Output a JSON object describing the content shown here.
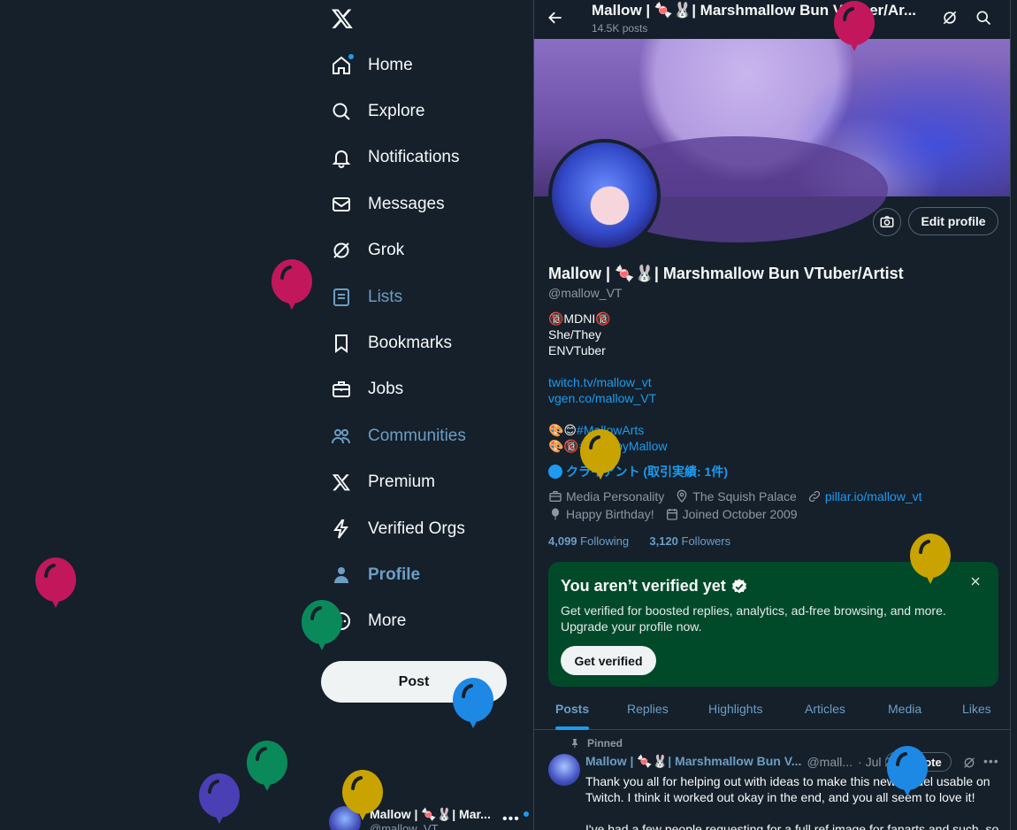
{
  "nav": {
    "items": [
      {
        "label": "Home",
        "icon": "home-icon"
      },
      {
        "label": "Explore",
        "icon": "search-icon"
      },
      {
        "label": "Notifications",
        "icon": "bell-icon"
      },
      {
        "label": "Messages",
        "icon": "mail-icon"
      },
      {
        "label": "Grok",
        "icon": "grok-icon"
      },
      {
        "label": "Lists",
        "icon": "list-icon"
      },
      {
        "label": "Bookmarks",
        "icon": "bookmark-icon"
      },
      {
        "label": "Jobs",
        "icon": "briefcase-icon"
      },
      {
        "label": "Communities",
        "icon": "communities-icon"
      },
      {
        "label": "Premium",
        "icon": "x-logo-icon"
      },
      {
        "label": "Verified Orgs",
        "icon": "lightning-icon"
      },
      {
        "label": "Profile",
        "icon": "person-icon"
      },
      {
        "label": "More",
        "icon": "more-circle-icon"
      }
    ],
    "post_label": "Post",
    "account": {
      "name": "Mallow | 🍬🐰| Mar...",
      "handle": "@mallow_VT"
    }
  },
  "header": {
    "title": "Mallow | 🍬🐰| Marshmallow Bun VTuber/Ar...",
    "post_count": "14.5K posts"
  },
  "profile": {
    "edit_label": "Edit profile",
    "name": "Mallow | 🍬🐰| Marshmallow Bun VTuber/Artist",
    "handle": "@mallow_VT",
    "bio": {
      "l1": "🔞MDNI🔞",
      "l2": "She/They",
      "l3": "ENVTuber",
      "link1": "twitch.tv/mallow_vt",
      "link2": "vgen.co/mallow_VT",
      "tag1_prefix": "🎨😊",
      "tag1": "#MallowArts",
      "tag2_prefix": "🎨🔞",
      "tag2": "#ChubbyMallow"
    },
    "client": "クライアント (取引実績: 1件)",
    "category": "Media Personality",
    "location": "The Squish Palace",
    "website": "pillar.io/mallow_vt",
    "birthday": "Happy Birthday!",
    "joined": "Joined October 2009",
    "following_count": "4,099",
    "following_label": "Following",
    "followers_count": "3,120",
    "followers_label": "Followers"
  },
  "verify_card": {
    "title": "You aren’t verified yet",
    "description": "Get verified for boosted replies, analytics, ad-free browsing, and more. Upgrade your profile now.",
    "button": "Get verified"
  },
  "tabs": [
    "Posts",
    "Replies",
    "Highlights",
    "Articles",
    "Media",
    "Likes"
  ],
  "active_tab": "Posts",
  "pinned_tweet": {
    "pinned_label": "Pinned",
    "author": "Mallow | 🍬🐰| Marshmallow Bun V...",
    "handle": "@mall...",
    "date": "· Jul 2",
    "promote_label": "Promote",
    "text1": "Thank you all for helping out with ideas to make this new model usable on Twitch. I think it worked out okay in the end, and you all seem to love it!",
    "text2": "I've had a few people requesting for a full ref image for fanarts and such, so"
  },
  "colors": {
    "background": "#15202b",
    "accent": "#1d9bf0",
    "muted_link": "#6c9ec4",
    "verify_card": "#004a2a",
    "balloon_colors": [
      "#c2185b",
      "#c2185b",
      "#c2185b",
      "#0a8a5a",
      "#0a8a5a",
      "#4a3fb5",
      "#c9a400",
      "#c9a400",
      "#c9a400",
      "#1e88e5",
      "#1e88e5"
    ]
  }
}
